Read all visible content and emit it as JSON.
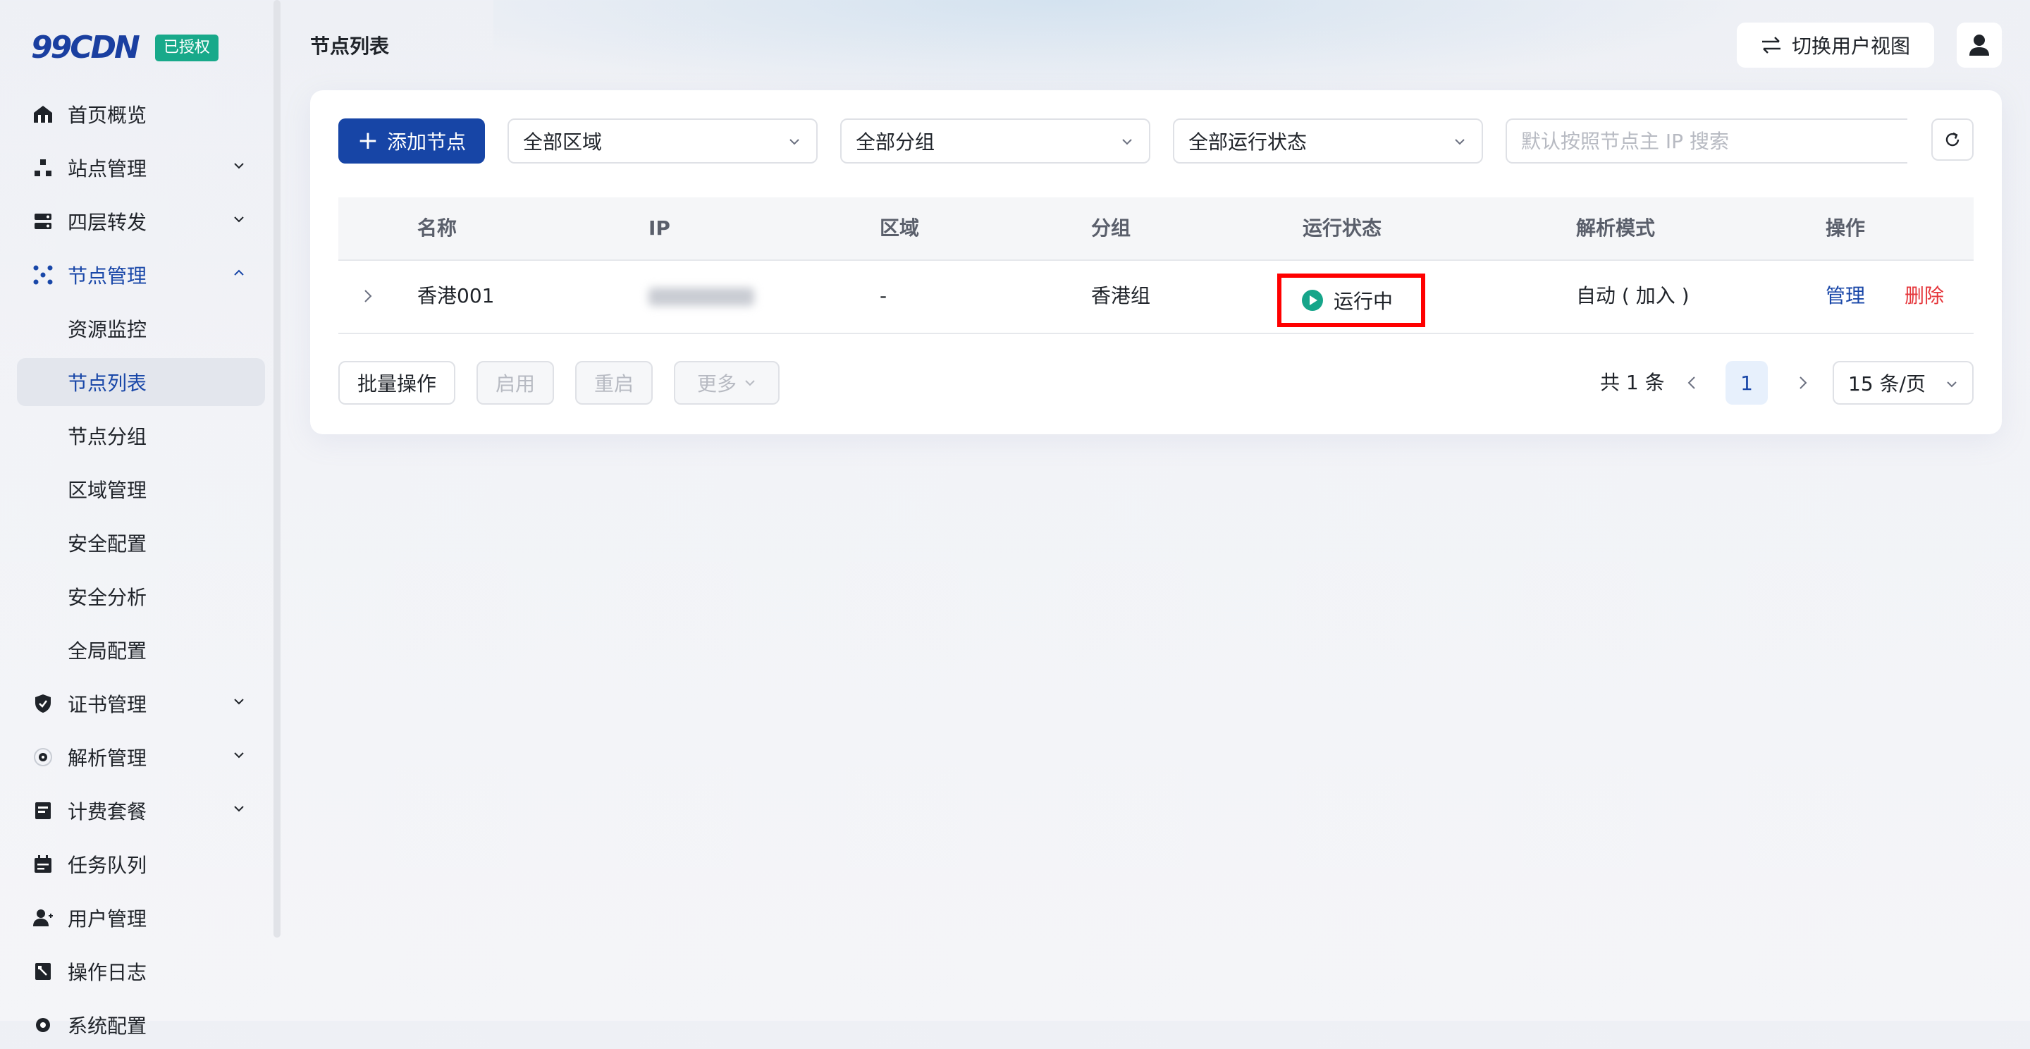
{
  "brand": {
    "logo": "99CDN",
    "license": "已授权"
  },
  "sidebar": {
    "items": [
      {
        "label": "首页概览",
        "icon": "home-icon",
        "expandable": false
      },
      {
        "label": "站点管理",
        "icon": "sitemap-icon",
        "expandable": true
      },
      {
        "label": "四层转发",
        "icon": "server-icon",
        "expandable": true
      },
      {
        "label": "节点管理",
        "icon": "node-network-icon",
        "expandable": true,
        "expanded": true,
        "active": true
      },
      {
        "label": "证书管理",
        "icon": "shield-icon",
        "expandable": true
      },
      {
        "label": "解析管理",
        "icon": "target-icon",
        "expandable": true
      },
      {
        "label": "计费套餐",
        "icon": "billing-icon",
        "expandable": true
      },
      {
        "label": "任务队列",
        "icon": "calendar-icon",
        "expandable": false
      },
      {
        "label": "用户管理",
        "icon": "user-icon",
        "expandable": false
      },
      {
        "label": "操作日志",
        "icon": "log-icon",
        "expandable": false
      },
      {
        "label": "系统配置",
        "icon": "settings-icon",
        "expandable": false
      }
    ],
    "subitems": [
      "资源监控",
      "节点列表",
      "节点分组",
      "区域管理",
      "安全配置",
      "安全分析",
      "全局配置"
    ],
    "selected_subitem": "节点列表"
  },
  "header": {
    "title": "节点列表",
    "switch_view": "切换用户视图"
  },
  "toolbar": {
    "add_label": "添加节点",
    "region_select": "全部区域",
    "group_select": "全部分组",
    "status_select": "全部运行状态",
    "search_placeholder": "默认按照节点主 IP 搜索"
  },
  "table": {
    "columns": [
      "名称",
      "IP",
      "区域",
      "分组",
      "运行状态",
      "解析模式",
      "操作"
    ],
    "rows": [
      {
        "name": "香港001",
        "ip": "",
        "region": "-",
        "group": "香港组",
        "status": "运行中",
        "resolve_mode": "自动 ( 加入 )",
        "actions": [
          "管理",
          "删除"
        ]
      }
    ]
  },
  "footer": {
    "batch": "批量操作",
    "enable": "启用",
    "restart": "重启",
    "more": "更多",
    "total": "共 1 条",
    "current_page": "1",
    "page_size": "15 条/页"
  },
  "colors": {
    "primary": "#1745a6",
    "license_badge": "#18a98a",
    "status_running": "#16a58a",
    "delete": "#e5363b",
    "highlight_box": "#ff0000"
  }
}
